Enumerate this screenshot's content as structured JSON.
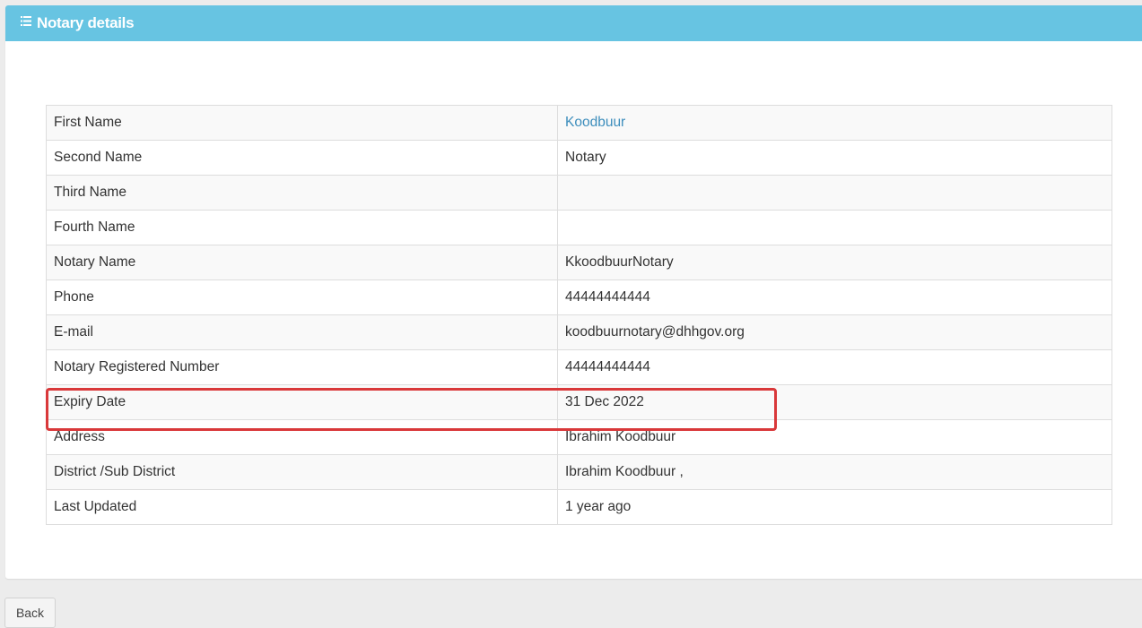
{
  "panel": {
    "title": "Notary details",
    "header_color": "#67c4e2",
    "header_icon": "list-icon"
  },
  "details": {
    "first_name": {
      "label": "First Name",
      "value": "Koodbuur"
    },
    "second_name": {
      "label": "Second Name",
      "value": "Notary"
    },
    "third_name": {
      "label": "Third Name",
      "value": ""
    },
    "fourth_name": {
      "label": "Fourth Name",
      "value": ""
    },
    "notary_name": {
      "label": "Notary Name",
      "value": "KkoodbuurNotary"
    },
    "phone": {
      "label": "Phone",
      "value": "44444444444"
    },
    "email": {
      "label": "E-mail",
      "value": "koodbuurnotary@dhhgov.org"
    },
    "registered_number": {
      "label": "Notary Registered Number",
      "value": "44444444444"
    },
    "expiry_date": {
      "label": "Expiry Date",
      "value": "31 Dec 2022"
    },
    "address": {
      "label": "Address",
      "value": "Ibrahim Koodbuur"
    },
    "district": {
      "label": "District /Sub District",
      "value": "Ibrahim Koodbuur ,"
    },
    "last_updated": {
      "label": "Last Updated",
      "value": "1 year ago"
    }
  },
  "link_color": "#3c8dbc",
  "highlight_color": "#d9383a",
  "footer": {
    "back_label": "Back"
  }
}
